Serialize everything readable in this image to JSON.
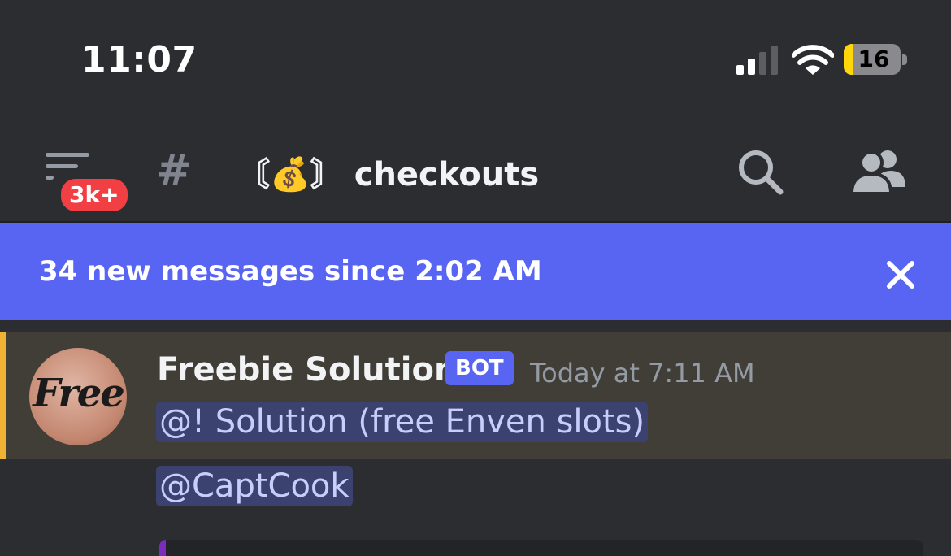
{
  "status_bar": {
    "time": "11:07",
    "battery_level": "16",
    "battery_fill_fraction": 0.16,
    "icons": [
      "cellular-signal-icon",
      "wifi-icon",
      "battery-charging-icon"
    ]
  },
  "header": {
    "menu_icon": "hamburger-menu-icon",
    "unread_badge": "3k+",
    "channel_prefix_icon": "hash-icon",
    "channel_name": "〘💰〙 checkouts",
    "search_icon": "search-icon",
    "members_icon": "members-icon"
  },
  "banner": {
    "text": "34 new messages since 2:02 AM",
    "close_icon": "close-icon"
  },
  "message": {
    "avatar_text": "Free",
    "author": "Freebie Solution",
    "tag": "BOT",
    "timestamp": "Today at 7:11 AM",
    "mentions": [
      "@! Solution (free Enven slots)",
      "@CaptCook"
    ]
  },
  "colors": {
    "background": "#2b2d31",
    "banner": "#5865f2",
    "badge": "#f23f43",
    "mention_highlight": "#413e38",
    "mention_bar": "#f0b232",
    "mention_pill": "#3c4270",
    "mention_text": "#c9cdfb"
  }
}
